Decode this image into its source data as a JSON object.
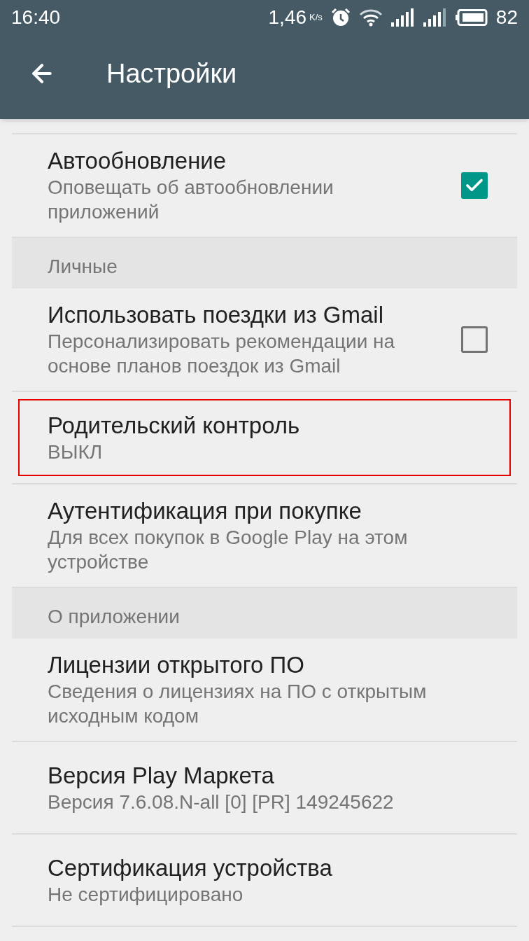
{
  "status_bar": {
    "time": "16:40",
    "speed": "1,46",
    "speed_unit": "K/s",
    "battery": "82"
  },
  "app_bar": {
    "title": "Настройки"
  },
  "items": [
    {
      "kind": "checkbox_setting",
      "title": "Автообновление",
      "summary": "Оповещать об автообновлении приложений",
      "checked": true,
      "highlighted": false
    },
    {
      "kind": "header",
      "title": "Личные"
    },
    {
      "kind": "checkbox_setting",
      "title": "Использовать поездки из Gmail",
      "summary": "Персонализировать рекомендации на основе планов поездок из Gmail",
      "checked": false,
      "highlighted": false
    },
    {
      "kind": "setting",
      "title": "Родительский контроль",
      "summary": "ВЫКЛ",
      "highlighted": true
    },
    {
      "kind": "setting",
      "title": "Аутентификация при покупке",
      "summary": "Для всех покупок в Google Play на этом устройстве",
      "highlighted": false
    },
    {
      "kind": "header",
      "title": "О приложении"
    },
    {
      "kind": "setting",
      "title": "Лицензии открытого ПО",
      "summary": "Сведения о лицензиях на ПО с открытым исходным кодом",
      "highlighted": false
    },
    {
      "kind": "setting",
      "title": "Версия Play Маркета",
      "summary": "Версия 7.6.08.N-all [0] [PR] 149245622",
      "highlighted": false
    },
    {
      "kind": "setting",
      "title": "Сертификация устройства",
      "summary": "Не сертифицировано",
      "highlighted": false
    }
  ]
}
